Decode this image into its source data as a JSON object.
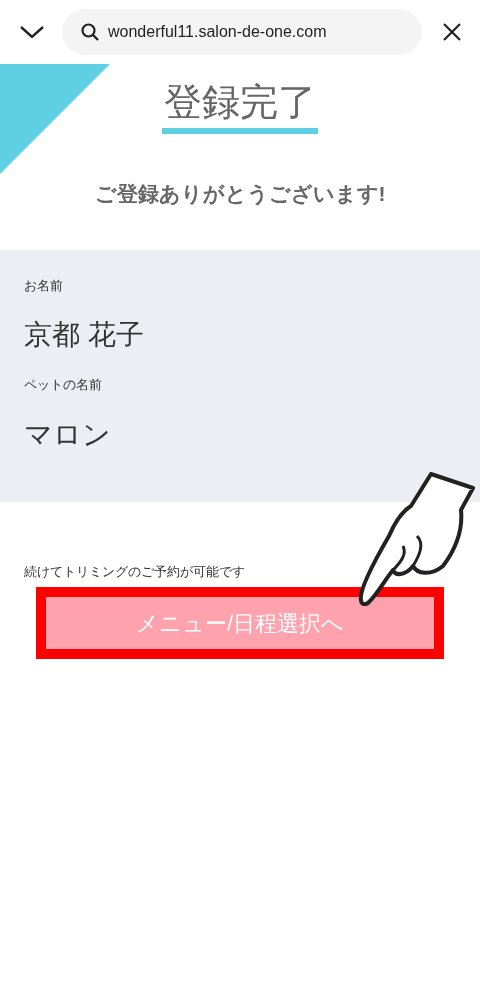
{
  "browser_bar": {
    "url": "wonderful11.salon-de-one.com"
  },
  "page": {
    "title": "登録完了",
    "message": "ご登録ありがとうございます!"
  },
  "details": [
    {
      "label": "お名前",
      "value": "京都 花子"
    },
    {
      "label": "ペットの名前",
      "value": "マロン"
    }
  ],
  "note": "続けてトリミングのご予約が可能です",
  "button": {
    "label": "メニュー/日程選択へ",
    "highlighted": true
  }
}
